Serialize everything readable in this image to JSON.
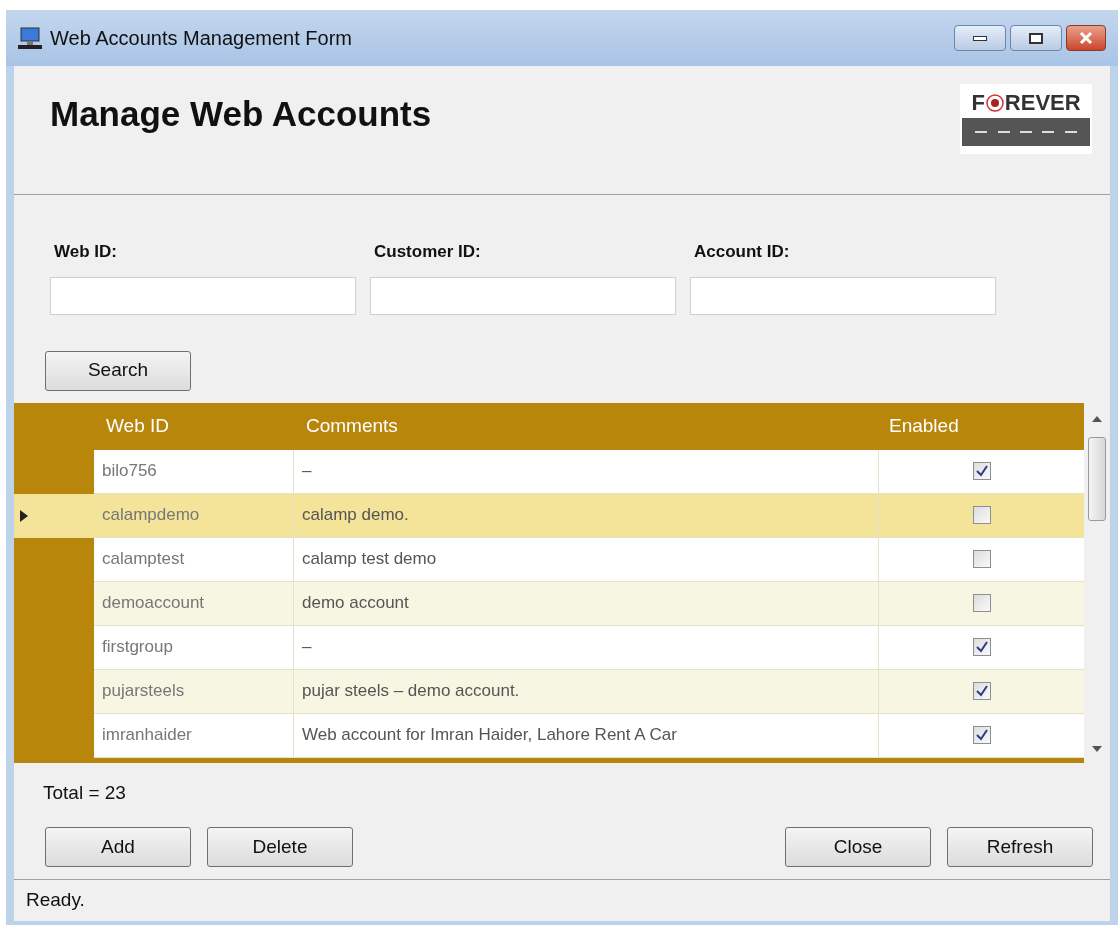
{
  "window": {
    "title": "Web Accounts Management Form"
  },
  "header": {
    "title": "Manage Web Accounts",
    "logo": {
      "text": "F",
      "text2": "REVER"
    }
  },
  "filters": [
    {
      "label": "Web ID:"
    },
    {
      "label": "Customer ID:"
    },
    {
      "label": "Account ID:"
    }
  ],
  "search_button": "Search",
  "table": {
    "columns": [
      "Web ID",
      "Comments",
      "Enabled"
    ],
    "rows": [
      {
        "web_id": "bilo756",
        "comments": "–",
        "enabled": true,
        "selected": false
      },
      {
        "web_id": "calampdemo",
        "comments": "calamp demo.",
        "enabled": false,
        "selected": true
      },
      {
        "web_id": "calamptest",
        "comments": "calamp test demo",
        "enabled": false,
        "selected": false
      },
      {
        "web_id": "demoaccount",
        "comments": "demo account",
        "enabled": false,
        "selected": false
      },
      {
        "web_id": "firstgroup",
        "comments": "–",
        "enabled": true,
        "selected": false
      },
      {
        "web_id": "pujarsteels",
        "comments": "pujar steels – demo account.",
        "enabled": true,
        "selected": false
      },
      {
        "web_id": "imranhaider",
        "comments": "Web account for Imran Haider, Lahore Rent A Car",
        "enabled": true,
        "selected": false
      }
    ]
  },
  "total": "Total = 23",
  "buttons_left": [
    "Add",
    "Delete"
  ],
  "buttons_right": [
    "Close",
    "Refresh"
  ],
  "status_bar": "Ready."
}
